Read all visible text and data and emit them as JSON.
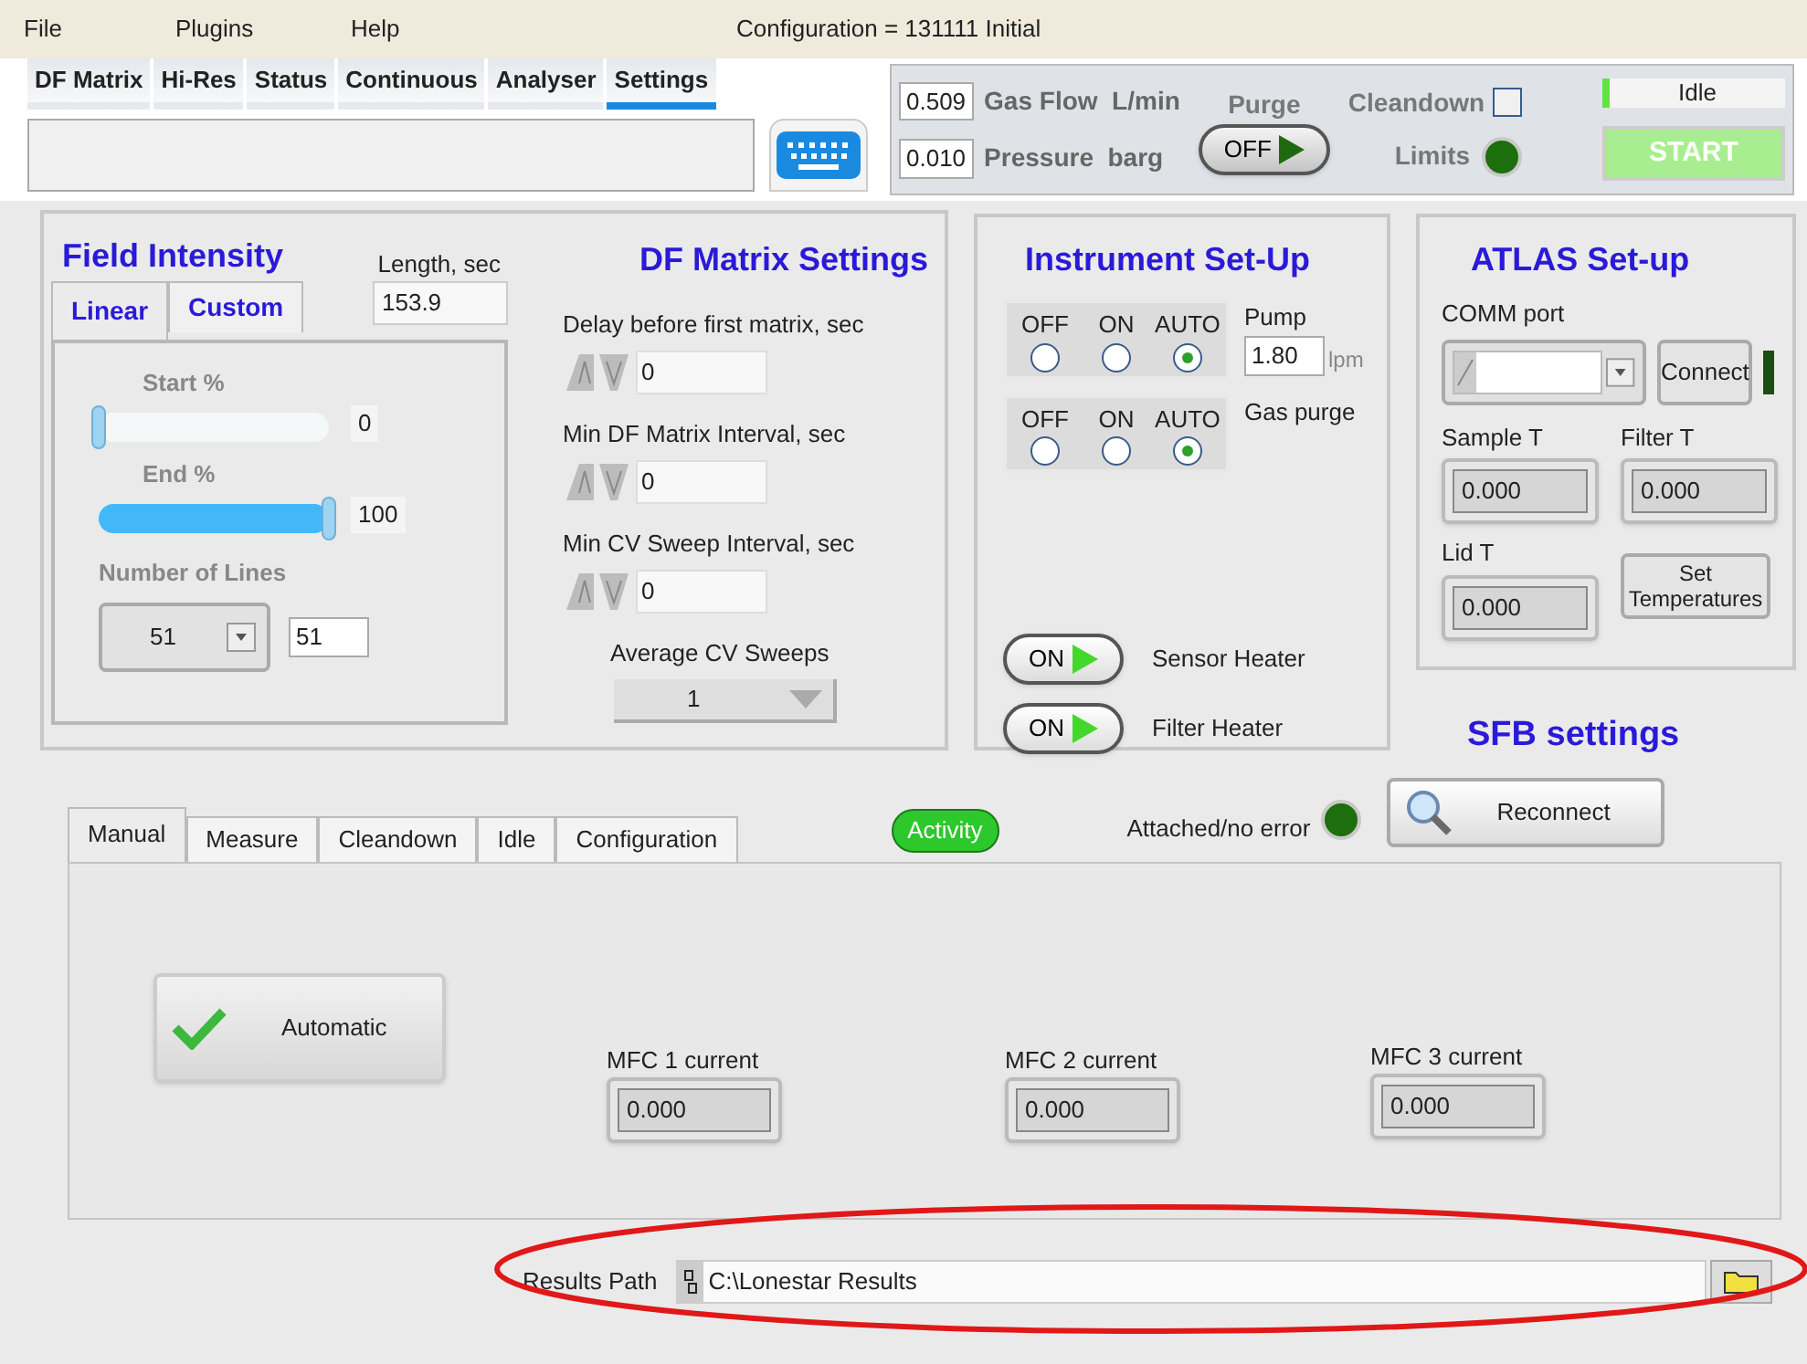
{
  "menu": [
    "File",
    "Plugins",
    "Help"
  ],
  "configuration": "Configuration = 131111 Initial",
  "main_tabs": [
    {
      "label": "DF Matrix",
      "selected": false
    },
    {
      "label": "Hi-Res",
      "selected": false
    },
    {
      "label": "Status",
      "selected": false
    },
    {
      "label": "Continuous",
      "selected": false
    },
    {
      "label": "Analyser",
      "selected": false
    },
    {
      "label": "Settings",
      "selected": true
    }
  ],
  "readouts": [
    {
      "value": "0.509",
      "label": "Gas Flow  L/min"
    },
    {
      "value": "0.010",
      "label": "Pressure  barg"
    }
  ],
  "purge": {
    "label": "Purge",
    "state": "OFF",
    "on": false
  },
  "cleandown": {
    "label": "Cleandown",
    "checked": false
  },
  "limits": {
    "label": "Limits",
    "lit": false
  },
  "status": {
    "text": "Idle"
  },
  "start_button": {
    "label": "START",
    "disabled": true
  },
  "field_intensity": {
    "title": "Field Intensity",
    "length_label": "Length, sec",
    "length_value": "153.9",
    "tabs": [
      {
        "label": "Linear",
        "selected": true
      },
      {
        "label": "Custom",
        "selected": false
      }
    ],
    "sliders": [
      {
        "label": "Start %",
        "level": 0,
        "reading": "0"
      },
      {
        "label": "End %",
        "level": 1,
        "reading": "100"
      }
    ],
    "lines_label": "Number of Lines",
    "lines_ring": "51",
    "lines_value": "51"
  },
  "df_matrix": {
    "title": "DF Matrix Settings",
    "numerics": [
      {
        "label": "Delay before first matrix, sec",
        "value": "0"
      },
      {
        "label": "Min DF Matrix Interval, sec",
        "value": "0"
      },
      {
        "label": "Min CV Sweep Interval, sec",
        "value": "0"
      }
    ],
    "average_label": "Average CV Sweeps",
    "average_value": "1"
  },
  "instrument": {
    "title": "Instrument Set-Up",
    "selectors": [
      {
        "label": "Pump",
        "value": "1.80",
        "unit": "lpm",
        "options": [
          {
            "label": "OFF",
            "selected": false
          },
          {
            "label": "ON",
            "selected": false
          },
          {
            "label": "AUTO",
            "selected": true
          }
        ]
      },
      {
        "label": "Gas purge",
        "options": [
          {
            "label": "OFF",
            "selected": false
          },
          {
            "label": "ON",
            "selected": false
          },
          {
            "label": "AUTO",
            "selected": true
          }
        ]
      }
    ],
    "switches": [
      {
        "state": "ON",
        "on": true,
        "label": "Sensor Heater"
      },
      {
        "state": "ON",
        "on": true,
        "label": "Filter Heater"
      }
    ]
  },
  "atlas": {
    "title": "ATLAS Set-up",
    "comm_label": "COMM port",
    "connect": {
      "label": "Connect",
      "lit": false
    },
    "temps": [
      {
        "label": "Sample T",
        "value": "0.000"
      },
      {
        "label": "Filter T",
        "value": "0.000"
      },
      {
        "label": "Lid T",
        "value": "0.000"
      }
    ],
    "set_button": "Set Temperatures"
  },
  "sfb": {
    "title": "SFB settings",
    "tabs": [
      {
        "label": "Manual",
        "selected": true
      },
      {
        "label": "Measure",
        "selected": false
      },
      {
        "label": "Cleandown",
        "selected": false
      },
      {
        "label": "Idle",
        "selected": false
      },
      {
        "label": "Configuration",
        "selected": false
      }
    ],
    "activity": {
      "label": "Activity",
      "lit": true
    },
    "attached": {
      "label": "Attached/no error",
      "lit": false
    },
    "reconnect": "Reconnect",
    "automatic": {
      "label": "Automatic",
      "checked": true
    },
    "mfcs": [
      {
        "label": "MFC 1 current",
        "value": "0.000"
      },
      {
        "label": "MFC 2 current",
        "value": "0.000"
      },
      {
        "label": "MFC 3 current",
        "value": "0.000"
      }
    ]
  },
  "results": {
    "label": "Results Path",
    "value": "C:\\Lonestar Results"
  }
}
